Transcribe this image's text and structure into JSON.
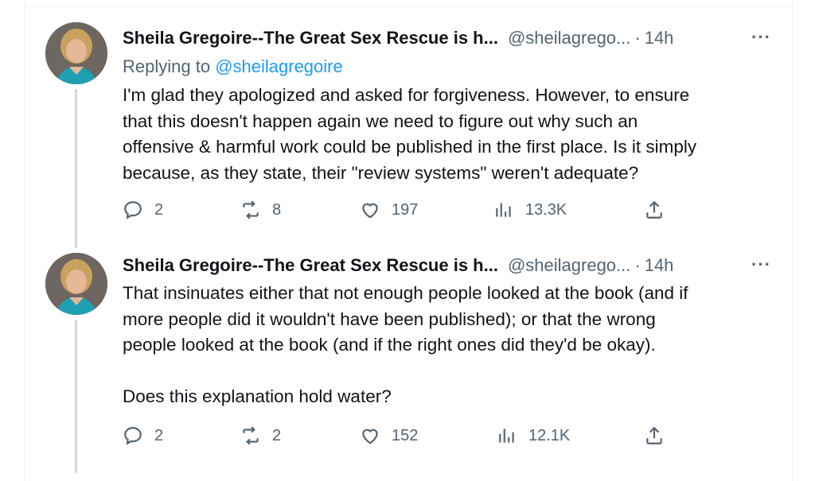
{
  "tweets": [
    {
      "author_name": "Sheila Gregoire--The Great Sex Rescue is h...",
      "handle": "@sheilagrego...",
      "separator": "·",
      "time": "14h",
      "more": "···",
      "replying_prefix": "Replying to ",
      "replying_to": "@sheilagregoire",
      "text": "I'm glad they apologized and asked for forgiveness. However, to ensure\nthat this doesn't happen again we need to figure out why such an\noffensive & harmful work could be published in the first place. Is it simply\nbecause, as they state, their \"review systems\" weren't adequate?",
      "stats": {
        "replies": "2",
        "retweets": "8",
        "likes": "197",
        "views": "13.3K"
      }
    },
    {
      "author_name": "Sheila Gregoire--The Great Sex Rescue is h...",
      "handle": "@sheilagrego...",
      "separator": "·",
      "time": "14h",
      "more": "···",
      "text": "That insinuates either that not enough people looked at the book (and if\nmore people did it wouldn't have been published); or that the wrong\npeople looked at the book (and if the right ones did they'd be okay).\n\nDoes this explanation hold water?",
      "stats": {
        "replies": "2",
        "retweets": "2",
        "likes": "152",
        "views": "12.1K"
      }
    }
  ],
  "colors": {
    "text": "#0f1419",
    "secondary": "#536471",
    "link": "#1d9bf0",
    "thread_line": "#cfd9de",
    "border": "#eff3f4"
  },
  "icons": [
    "reply-icon",
    "retweet-icon",
    "like-icon",
    "views-icon",
    "share-icon",
    "more-icon"
  ]
}
